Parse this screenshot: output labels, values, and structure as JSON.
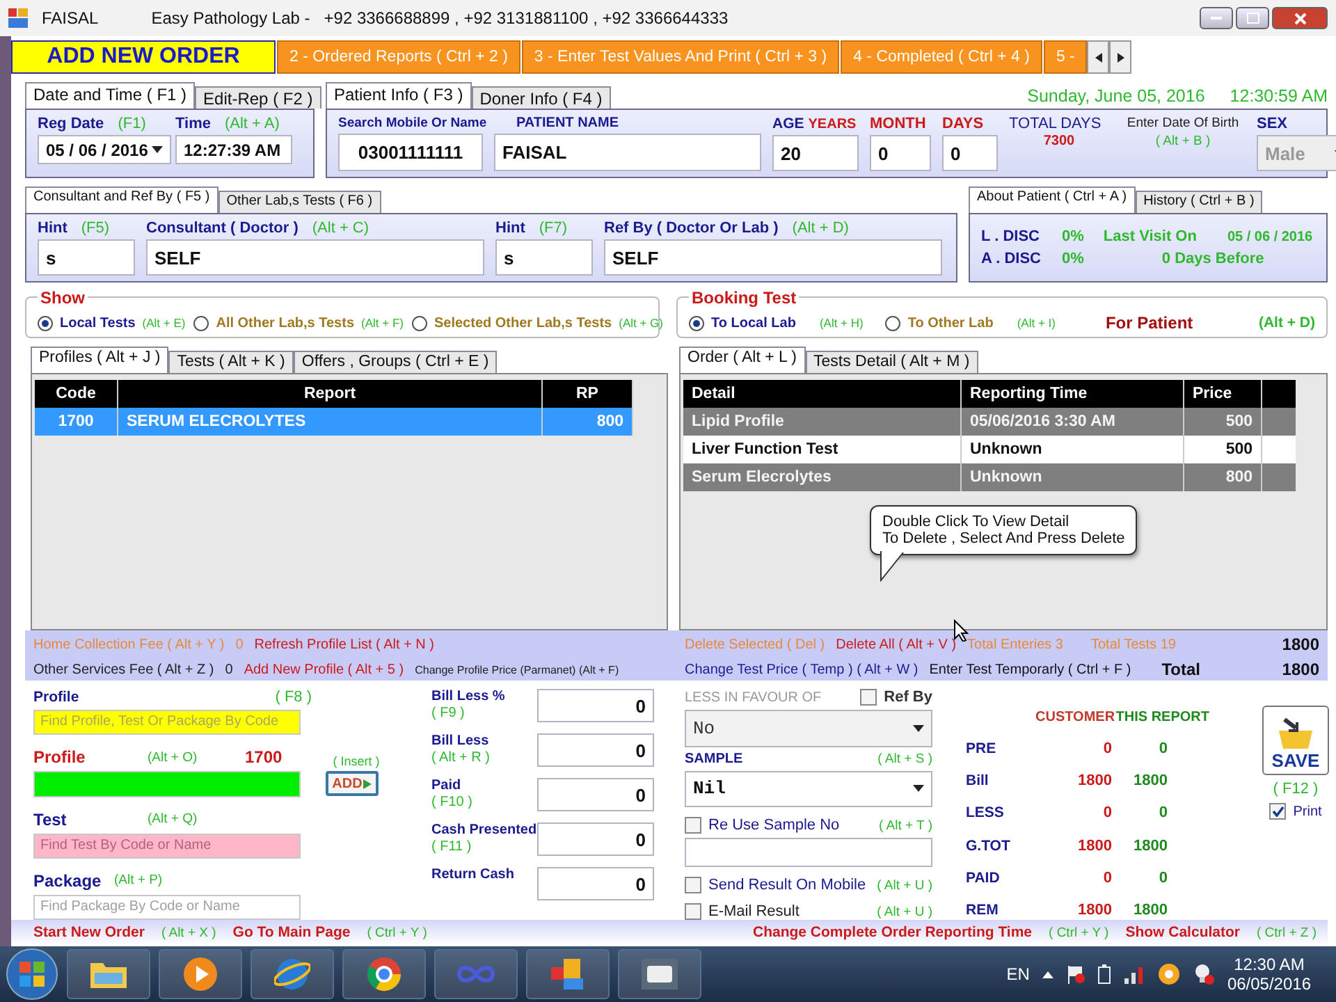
{
  "window": {
    "title": "FAISAL",
    "subtitle": "Easy Pathology Lab -",
    "phones": "+92 3366688899  , +92 3131881100  , +92 3366644333"
  },
  "main_tabs": [
    {
      "label": "ADD NEW ORDER",
      "selected": true
    },
    {
      "label": "2 - Ordered Reports ( Ctrl + 2 )",
      "selected": false
    },
    {
      "label": "3 - Enter Test Values And Print ( Ctrl + 3 )",
      "selected": false
    },
    {
      "label": "4 - Completed ( Ctrl + 4 )",
      "selected": false
    },
    {
      "label": "5 -",
      "selected": false
    }
  ],
  "clock": {
    "date": "Sunday, June 05, 2016",
    "time": "12:30:59 AM"
  },
  "date_group": {
    "tabs": [
      {
        "label": "Date and Time ( F1 )",
        "selected": true
      },
      {
        "label": "Edit-Rep ( F2 )",
        "selected": false
      }
    ],
    "reg_date_label": "Reg Date",
    "reg_date_key": "(F1)",
    "reg_date": "05 / 06 / 2016",
    "time_label": "Time",
    "time_key": "(Alt + A)",
    "time": "12:27:39 AM"
  },
  "patient_group": {
    "tabs": [
      {
        "label": "Patient Info ( F3 )",
        "selected": true
      },
      {
        "label": "Doner Info ( F4 )",
        "selected": false
      }
    ],
    "search_label": "Search Mobile Or Name",
    "mobile": "03001111111",
    "name_label": "PATIENT NAME",
    "name": "FAISAL",
    "age_label": "AGE",
    "years_label": "YEARS",
    "years": "20",
    "month_label": "MONTH",
    "month": "0",
    "days_label": "DAYS",
    "days": "0",
    "total_days_label": "TOTAL DAYS",
    "total_days": "7300",
    "dob_label": "Enter Date Of Birth",
    "dob_key": "( Alt + B )",
    "sex_label": "SEX",
    "sex": "Male"
  },
  "consultant_group": {
    "tabs": [
      {
        "label": "Consultant and Ref By  ( F5 )",
        "selected": true
      },
      {
        "label": "Other Lab,s Tests ( F6 )",
        "selected": false
      }
    ],
    "fields": [
      {
        "label": "Hint",
        "key": "(F5)",
        "value": "s"
      },
      {
        "label": "Consultant  ( Doctor )",
        "key": "(Alt + C)",
        "value": "SELF"
      },
      {
        "label": "Hint",
        "key": "(F7)",
        "value": "s"
      },
      {
        "label": "Ref By  ( Doctor  Or  Lab )",
        "key": "(Alt + D)",
        "value": "SELF"
      }
    ]
  },
  "about_group": {
    "tabs": [
      {
        "label": "About Patient ( Ctrl + A )",
        "selected": true
      },
      {
        "label": "History ( Ctrl + B )",
        "selected": false
      }
    ],
    "l_disc_label": "L . DISC",
    "l_disc": "0%",
    "last_visit_label": "Last Visit On",
    "last_visit": "05 / 06 / 2016",
    "a_disc_label": "A . DISC",
    "a_disc": "0%",
    "days_before": "0 Days Before"
  },
  "show_group": {
    "title": "Show",
    "options": [
      {
        "label": "Local Tests",
        "key": "(Alt + E)",
        "selected": true
      },
      {
        "label": "All  Other Lab,s Tests",
        "key": "(Alt + F)",
        "selected": false
      },
      {
        "label": "Selected Other Lab,s Tests",
        "key": "(Alt + G)",
        "selected": false
      }
    ]
  },
  "booking_group": {
    "title": "Booking Test",
    "options": [
      {
        "label": "To Local Lab",
        "key": "(Alt + H)",
        "selected": true
      },
      {
        "label": "To Other Lab",
        "key": "(Alt + I)",
        "selected": false
      }
    ],
    "for_patient": "For Patient",
    "for_patient_key": "(Alt + D)"
  },
  "profiles_panel": {
    "tabs": [
      {
        "label": "Profiles  ( Alt + J )",
        "selected": true
      },
      {
        "label": "Tests ( Alt + K )",
        "selected": false
      },
      {
        "label": "Offers , Groups ( Ctrl + E )",
        "selected": false
      }
    ],
    "columns": [
      "Code",
      "Report",
      "RP"
    ],
    "rows": [
      {
        "cells": [
          "1700",
          "SERUM ELECROLYTES",
          "800"
        ],
        "selected": true
      }
    ]
  },
  "order_panel": {
    "tabs": [
      {
        "label": "Order ( Alt + L )",
        "selected": true
      },
      {
        "label": "Tests Detail  ( Alt + M )",
        "selected": false
      }
    ],
    "columns": [
      "Detail",
      "Reporting Time",
      "Price"
    ],
    "rows": [
      {
        "cells": [
          "Lipid Profile",
          "05/06/2016 3:30 AM",
          "500"
        ],
        "kind": "shaded"
      },
      {
        "cells": [
          "Liver Function Test",
          "Unknown",
          "500"
        ],
        "kind": "plain"
      },
      {
        "cells": [
          "Serum Elecrolytes",
          "Unknown",
          "800"
        ],
        "kind": "shaded"
      }
    ],
    "tooltip": [
      "Double Click To View Detail",
      "To Delete , Select And Press Delete"
    ]
  },
  "left_footer": {
    "home_fee_label": "Home Collection Fee ( Alt + Y )",
    "home_fee": "0",
    "refresh_link": "Refresh Profile List ( Alt + N )",
    "other_fee_label": "Other Services  Fee ( Alt + Z )",
    "other_fee": "0",
    "add_profile_link": "Add New Profile ( Alt + 5 )",
    "change_profile_price": "Change Profile Price (Parmanet) (Alt + F)"
  },
  "right_footer": {
    "delete_selected": "Delete Selected ( Del )",
    "delete_all": "Delete All ( Alt + V )",
    "total_entries": "Total Enteries 3",
    "total_tests": "Total Tests 19",
    "subtotal": "1800",
    "change_test_price": "Change Test Price ( Temp )  ( Alt + W )",
    "enter_test_temp": "Enter Test Temporarly ( Ctrl + F )",
    "total_label": "Total",
    "total": "1800"
  },
  "search": {
    "profile_find": {
      "label": "Profile",
      "key": "( F8 )",
      "placeholder": "Find Profile, Test Or Package By Code"
    },
    "profile": {
      "label": "Profile",
      "key": "(Alt + O)",
      "code": "1700"
    },
    "insert_key": "( Insert )",
    "add_button": "ADD",
    "test": {
      "label": "Test",
      "key": "(Alt + Q)",
      "placeholder": "Find Test By Code or Name"
    },
    "package": {
      "label": "Package",
      "key": "(Alt + P)",
      "placeholder": "Find Package By Code or Name"
    }
  },
  "bill_fields": [
    {
      "label": "Bill Less %",
      "key": "( F9 )",
      "value": "0"
    },
    {
      "label": "Bill Less",
      "key": "( Alt + R )",
      "value": "0"
    },
    {
      "label": "Paid",
      "key": "( F10 )",
      "value": "0"
    },
    {
      "label": "Cash Presented",
      "key": "( F11 )",
      "value": "0"
    },
    {
      "label": "Return Cash",
      "value": "0"
    }
  ],
  "options": {
    "less_favour_label": "LESS IN FAVOUR OF",
    "ref_by": {
      "label": "Ref By",
      "checked": false
    },
    "less_favour": "No",
    "sample_label": "SAMPLE",
    "sample_key": "( Alt + S )",
    "sample": "Nil",
    "reuse": {
      "label": "Re Use Sample  No",
      "key": "( Alt + T )",
      "checked": false
    },
    "send_mobile": {
      "label": "Send Result On Mobile",
      "key": "( Alt + U )",
      "checked": false
    },
    "email": {
      "label": "E-Mail Result",
      "key": "( Alt + U )",
      "checked": false
    }
  },
  "summary": {
    "headers": [
      "CUSTOMER",
      "THIS REPORT"
    ],
    "rows": [
      {
        "label": "PRE",
        "customer": "0",
        "report": "0"
      },
      {
        "label": "Bill",
        "customer": "1800",
        "report": "1800"
      },
      {
        "label": "LESS",
        "customer": "0",
        "report": "0"
      },
      {
        "label": "G.TOT",
        "customer": "1800",
        "report": "1800"
      },
      {
        "label": "PAID",
        "customer": "0",
        "report": "0"
      },
      {
        "label": "REM",
        "customer": "1800",
        "report": "1800"
      }
    ]
  },
  "save": {
    "label": "SAVE",
    "key": "( F12 )",
    "print": {
      "label": "Print",
      "checked": true
    }
  },
  "bottom_links": {
    "left": [
      {
        "text": "Start New Order",
        "key": "( Alt + X )"
      },
      {
        "text": "Go To Main Page",
        "key": "( Ctrl + Y )"
      }
    ],
    "right": [
      {
        "text": "Change Complete Order Reporting Time",
        "key": "( Ctrl + Y )"
      },
      {
        "text": "Show Calculator",
        "key": "( Ctrl + Z )"
      }
    ]
  },
  "taskbar": {
    "language": "EN",
    "time": "12:30 AM",
    "date": "06/05/2016"
  }
}
